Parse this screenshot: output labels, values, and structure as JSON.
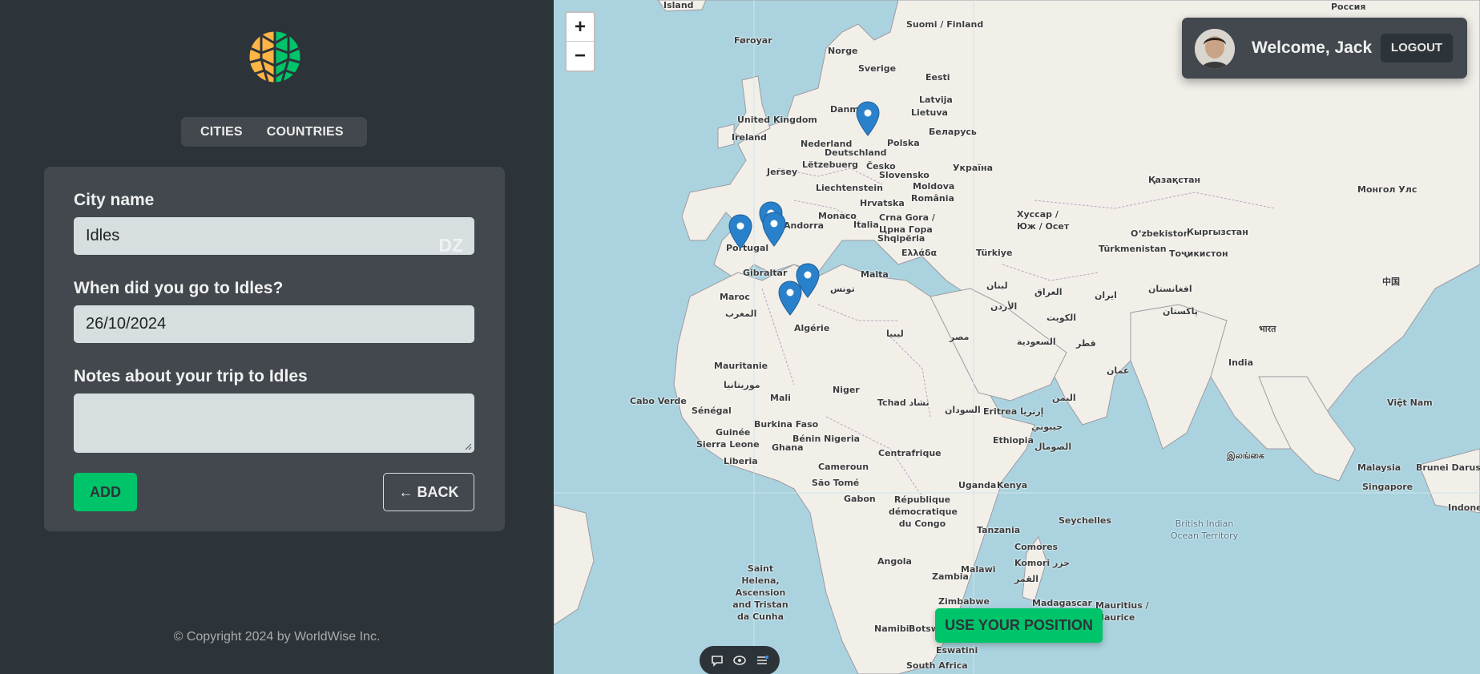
{
  "sidebar": {
    "tabs": [
      {
        "label": "CITIES"
      },
      {
        "label": "COUNTRIES"
      }
    ],
    "form": {
      "city_label": "City name",
      "city_value": "Idles",
      "city_flag": "DZ",
      "date_label": "When did you go to Idles?",
      "date_value": "26/10/2024",
      "notes_label": "Notes about your trip to Idles",
      "notes_value": "",
      "add_label": "ADD",
      "back_label": "← BACK"
    },
    "copyright": "© Copyright 2024 by WorldWise Inc."
  },
  "map": {
    "zoom_in": "+",
    "zoom_out": "−",
    "use_position_label": "USE YOUR POSITION",
    "labels": {
      "island": "Island",
      "rossiya": "Россия",
      "suomi": "Suomi / Finland",
      "foroyar": "Føroyar",
      "norge": "Norge",
      "sverige": "Sverige",
      "eesti": "Eesti",
      "latvija": "Latvija",
      "lietuva": "Lietuva",
      "uk": "United Kingdom",
      "danmark": "Danm",
      "ireland": "Ireland",
      "nederland": "Nederland",
      "deutschland": "Deutschland",
      "polska": "Polska",
      "belarus": "Беларусь",
      "jersey": "Jersey",
      "letzebuerg": "Lëtzebuerg",
      "cesko": "Česko",
      "slovensko": "Slovensko",
      "ukraina": "Україна",
      "liechtenstein": "Liechtenstein",
      "moldova": "Moldova",
      "hrvatska": "Hrvatska",
      "romania": "România",
      "monaco": "Monaco",
      "andorra": "Andorra",
      "italia": "Italia",
      "crnagora": "Crna Gora / Црна Гора",
      "shqiperia": "Shqipëria",
      "ellada": "Ελλάδα",
      "portugal": "Portugal",
      "turkiye": "Türkiye",
      "gibraltar": "Gibraltar",
      "malta": "Malta",
      "tunes": "تونس",
      "maroc": "Maroc",
      "almaghrib": "المغرب",
      "algerie": "Algérie",
      "libya": "ليبيا",
      "misr": "مصر",
      "lubnan": "لبنان",
      "alurdun": "الأردن",
      "iraq": "العراق",
      "iran": "ایران",
      "kuwait": "الكويت",
      "saudi": "السعودية",
      "qatar": "قطر",
      "oman": "عمان",
      "yemen": "اليمن",
      "kazakhstan": "Қазақстан",
      "mongol": "Монгол Улс",
      "uzbekiston": "O‘zbekiston",
      "kyrgyzstan": "Кыргызстан",
      "turkmenistan": "Türkmenistan",
      "tojikiston": "Тоҷикистон",
      "afghanistan": "افغانستان",
      "pakistan": "پاکستان",
      "zhongguo": "中国",
      "india": "India",
      "khazar": "Хуссар / Юж / Осет",
      "mauritanie": "Mauritanie",
      "muritaniya": "موريتانيا",
      "mali": "Mali",
      "niger": "Niger",
      "tchad": "Tchad تشاد",
      "sudan": "السودان",
      "eritrea": "Eritrea إرتريا",
      "ethiopia": "Ethiopia",
      "jabuuti": "جيبوتي",
      "somalia": "الصومال",
      "capeverde": "Cabo Verde",
      "senegal": "Sénégal",
      "guinee": "Guinée",
      "sierraleone": "Sierra Leone",
      "liberia": "Liberia",
      "burkina": "Burkina Faso",
      "ghana": "Ghana",
      "benin": "Bénin Nigeria",
      "cameroun": "Cameroun",
      "centrafrique": "Centrafrique",
      "saotome": "São Tomé",
      "gabon": "Gabon",
      "rdc": "République démocratique du Congo",
      "uganda": "Uganda",
      "kenya": "Kenya",
      "tanzania": "Tanzania",
      "angola": "Angola",
      "zambia": "Zambia",
      "malawi": "Malawi",
      "seychelles": "Seychelles",
      "comores": "Comores Komori جزر القمر",
      "madagascar": "Madagascar",
      "mauritius": "Mauritius / Maurice",
      "zimbabwe": "Zimbabwe",
      "namibia": "Namibia",
      "botswana": "Botsw",
      "eswatini": "Eswatini",
      "southafrica": "South Africa",
      "sainthelena": "Saint Helena, Ascension and Tristan da Cunha",
      "biot": "British Indian Ocean Territory",
      "srilanka": "இலங்கை",
      "bharat": "भारत",
      "vietnam": "Việt Nam",
      "malaysia": "Malaysia",
      "brunei": "Brunei Darussa",
      "singapore": "Singapore",
      "indonesia": "Indones"
    }
  },
  "user": {
    "welcome": "Welcome, Jack",
    "logout_label": "LOGOUT"
  },
  "colors": {
    "sidebar_bg": "#2d3439",
    "panel_bg": "#42484d",
    "accent_green": "#00c46a",
    "input_bg": "#d6dee0",
    "water": "#aad3df",
    "land": "#f2efe9",
    "marker_blue": "#2a81cb"
  },
  "icons": [
    "logo-icon",
    "avatar",
    "chat-icon",
    "eye-icon",
    "menu-icon",
    "map-marker-icon"
  ]
}
